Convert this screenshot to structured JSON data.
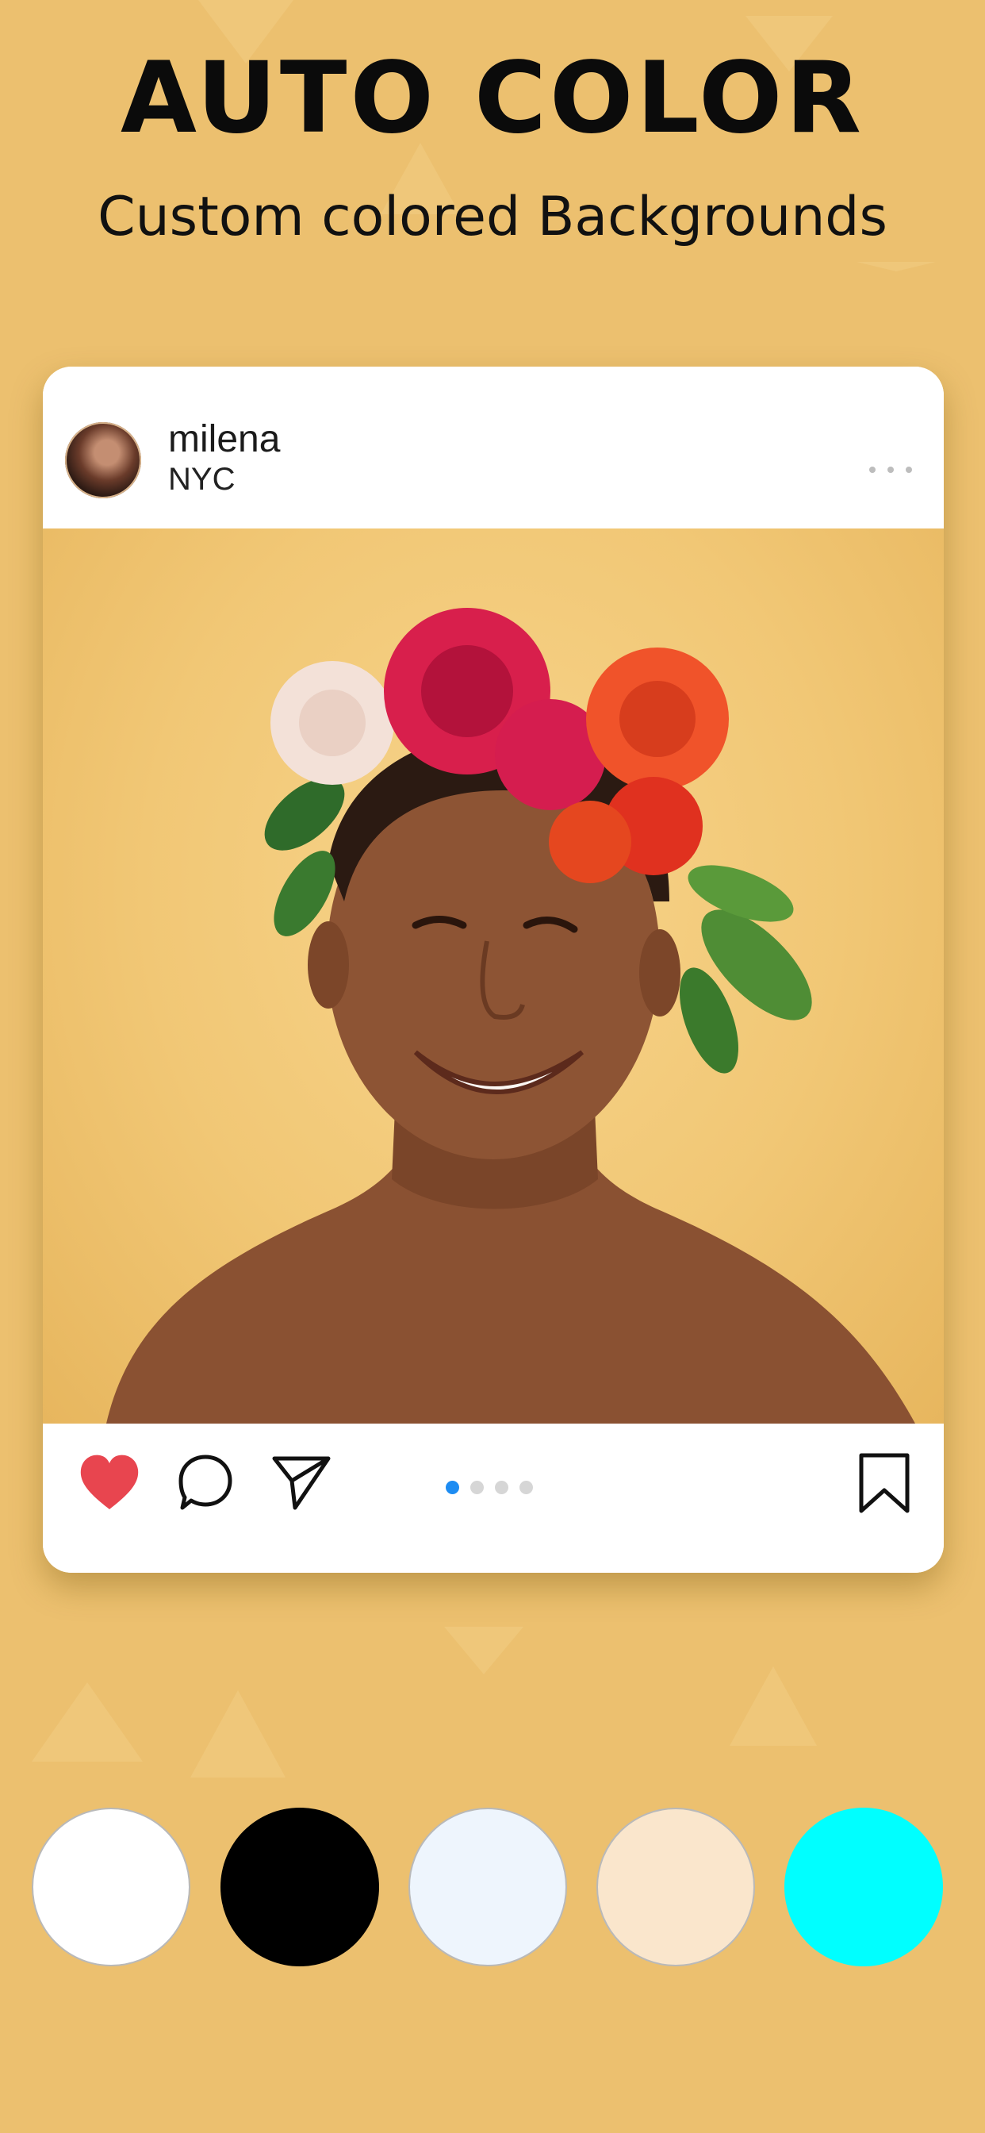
{
  "promo": {
    "headline": "AUTO COLOR",
    "subheadline": "Custom colored Backgrounds"
  },
  "post": {
    "username": "milena",
    "location": "NYC",
    "carousel": {
      "page_count": 4,
      "active_index": 0
    },
    "liked": true
  },
  "swatches": [
    {
      "name": "white",
      "color": "#FFFFFF"
    },
    {
      "name": "black",
      "color": "#000000"
    },
    {
      "name": "alice-blue",
      "color": "#EEF5FD"
    },
    {
      "name": "cream",
      "color": "#FAE6CC"
    },
    {
      "name": "cyan",
      "color": "#00FFFF"
    }
  ],
  "colors": {
    "page_background": "#ECC06F",
    "accent_blue": "#1D8CF2",
    "like_red": "#E8454F"
  }
}
